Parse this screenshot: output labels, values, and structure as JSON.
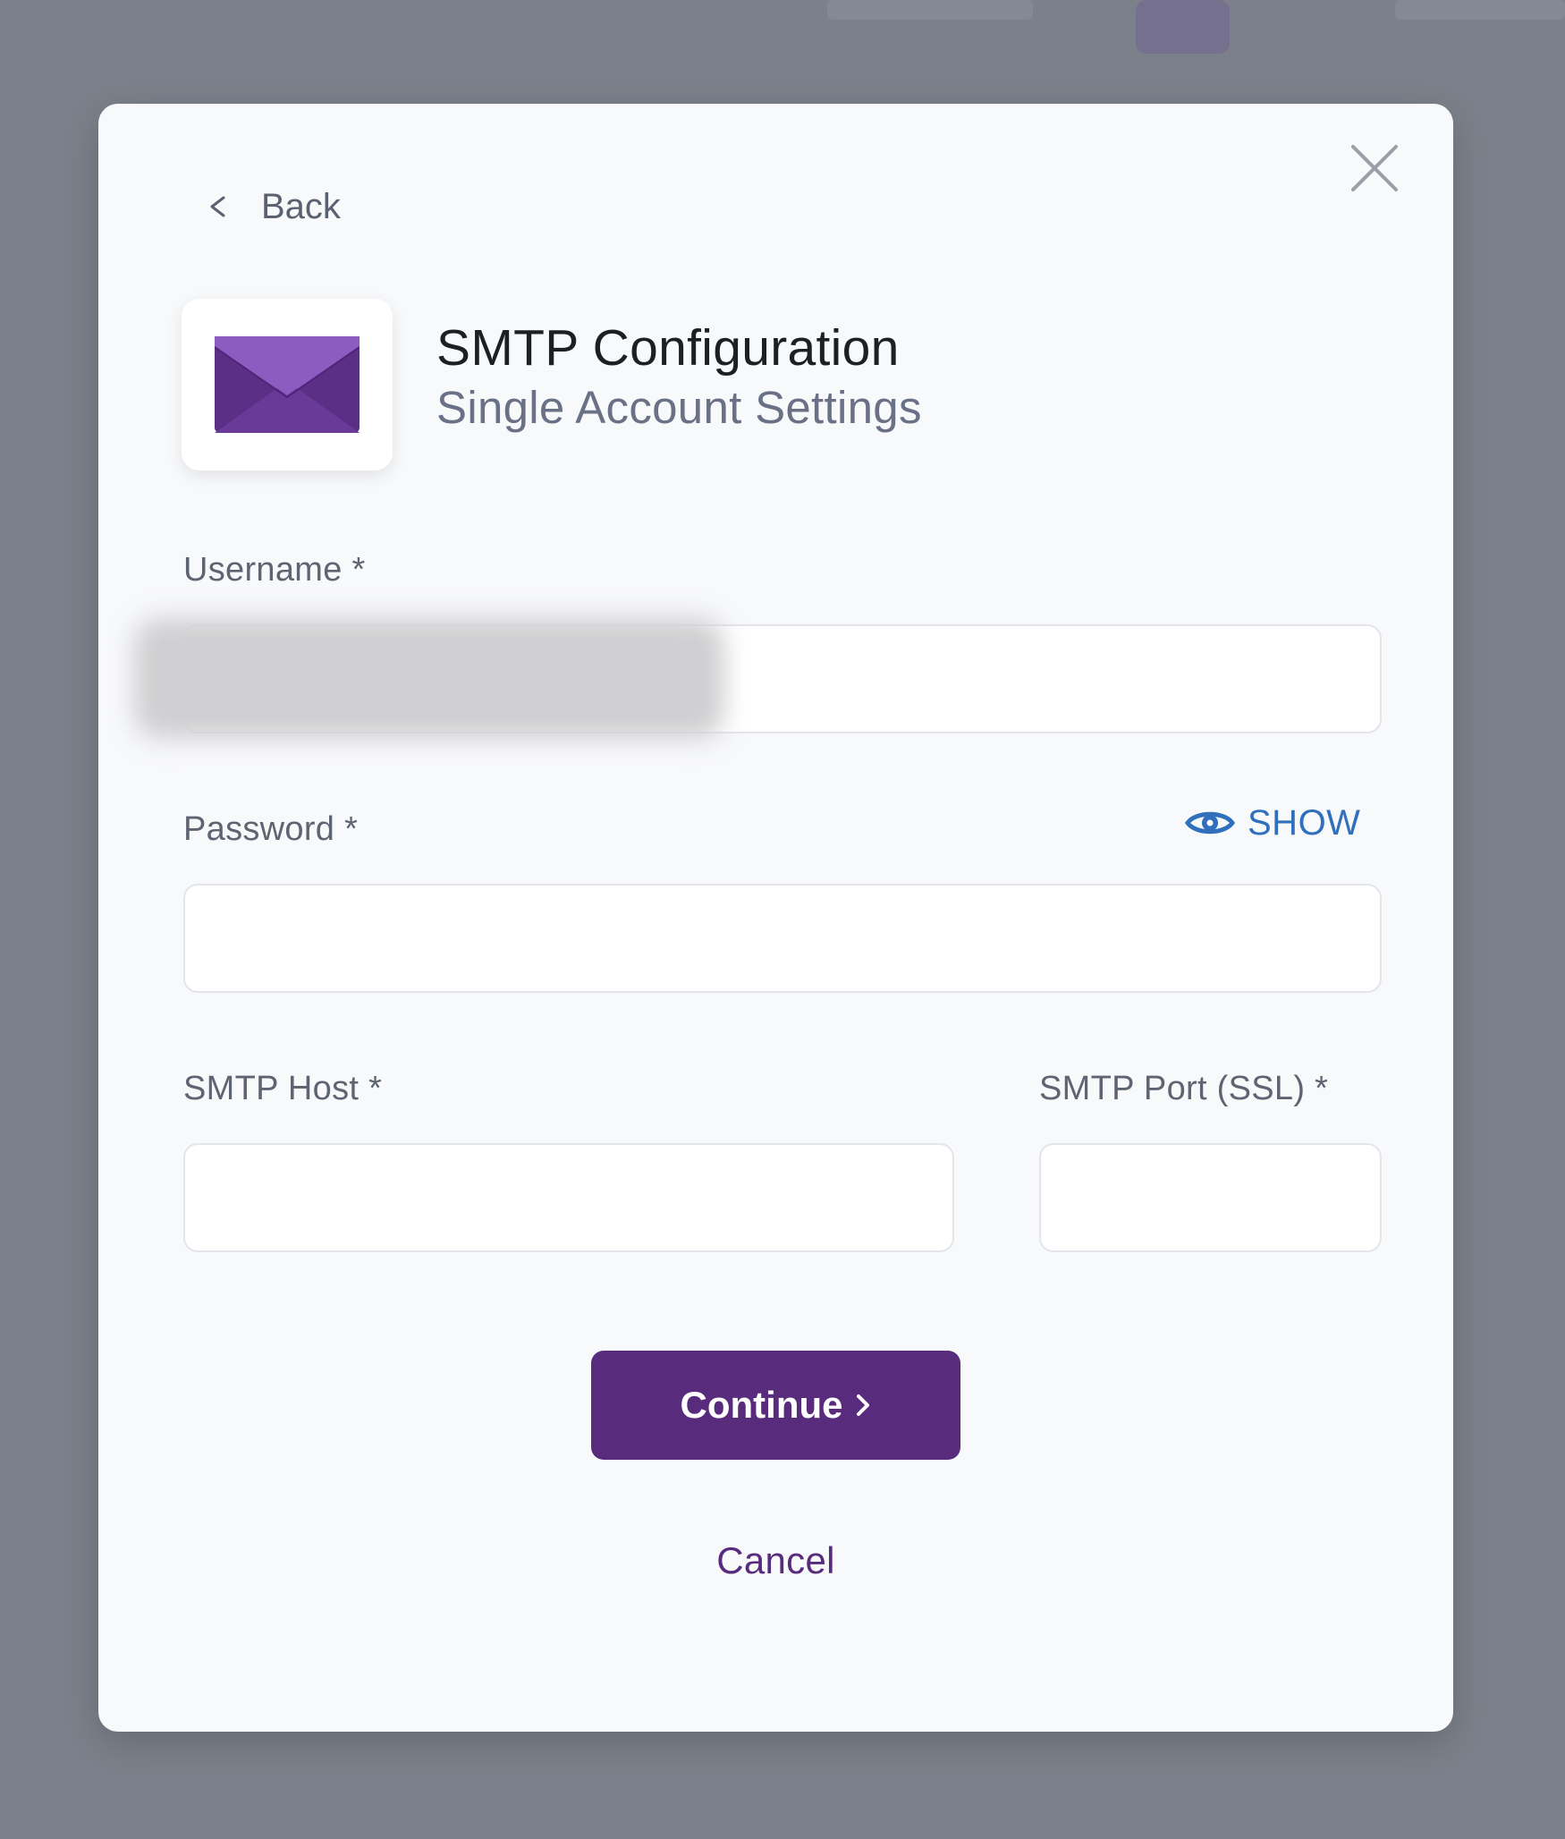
{
  "dialog": {
    "back_label": "Back",
    "title": "SMTP Configuration",
    "subtitle": "Single Account Settings"
  },
  "form": {
    "username": {
      "label": "Username *",
      "value": "",
      "redacted": true
    },
    "password": {
      "label": "Password *",
      "value": "",
      "show_label": "SHOW"
    },
    "smtp_host": {
      "label": "SMTP Host *",
      "value": ""
    },
    "smtp_port": {
      "label": "SMTP Port (SSL) *",
      "value": ""
    }
  },
  "actions": {
    "continue_label": "Continue",
    "cancel_label": "Cancel"
  },
  "icons": {
    "logo": "envelope-icon",
    "close": "close-icon",
    "back": "chevron-left-icon",
    "show": "eye-icon",
    "continue": "chevron-right-icon"
  },
  "colors": {
    "primary": "#582b7d",
    "envelope_light": "#8e5bc0",
    "envelope_dark": "#5b2f86",
    "link_blue": "#2f6fbb",
    "overlay": "#7c808a"
  }
}
